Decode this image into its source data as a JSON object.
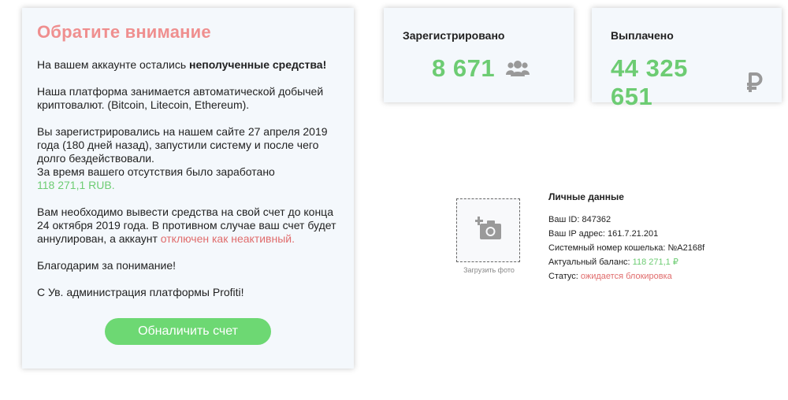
{
  "notice": {
    "title": "Обратите внимание",
    "p1_prefix": "На вашем аккаунте остались ",
    "p1_bold": "неполученные средства!",
    "p2": "Наша платформа занимается автоматической добычей криптовалют. (Bitcoin, Litecoin, Ethereum).",
    "p3_text": "Вы зарегистрировались на нашем сайте 27 апреля 2019 года (180 дней назад), запустили систему и после чего долго бездействовали.",
    "p3_earned": "За время вашего отсутствия было заработано",
    "p3_amount": "118 271,1 RUB.",
    "p4_text": "Вам необходимо вывести средства на свой счет до конца 24 октября 2019 года. В противном случае ваш счет будет аннулирован, а аккаунт ",
    "p4_red": "отключен как неактивный.",
    "p5": "Благодарим за понимание!",
    "p6": "С Ув. администрация платформы Profiti!",
    "button": "Обналичить счет"
  },
  "stats": {
    "registered": {
      "label": "Зарегистрировано",
      "value": "8 671",
      "icon": "users-icon"
    },
    "paid": {
      "label": "Выплачено",
      "value": "44 325 651",
      "icon": "ruble-icon"
    }
  },
  "photo": {
    "caption": "Загрузить фото",
    "icon": "add-photo-icon"
  },
  "personal": {
    "title": "Личные данные",
    "id_label": "Ваш ID: ",
    "id_value": "847362",
    "ip_label": "Ваш IP адрес: ",
    "ip_value": "161.7.21.201",
    "wallet_label": "Системный номер кошелька: ",
    "wallet_value": "№A2168f",
    "balance_label": "Актуальный баланс: ",
    "balance_value": "118 271,1 ₽",
    "status_label": "Статус: ",
    "status_value": "ожидается блокировка"
  },
  "colors": {
    "accent_green": "#6dcc73",
    "button_green": "#6dd873",
    "warn_red": "#e06c6c",
    "title_pink": "#ef8f8f"
  }
}
